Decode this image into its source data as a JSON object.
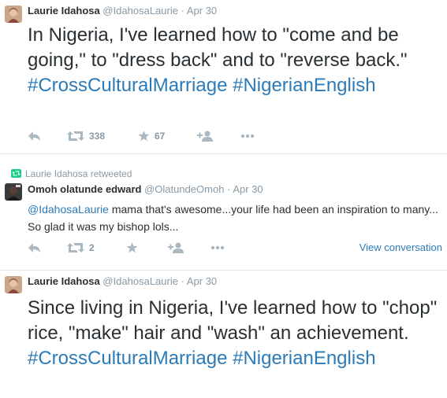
{
  "tweets": [
    {
      "name": "Laurie Idahosa",
      "handle": "@IdahosaLaurie",
      "dot": "·",
      "date": "Apr 30",
      "text_parts": [
        "In Nigeria, I've learned how to \"come and be going,\" to \"dress back\" and to \"reverse back.\" ",
        "#CrossCulturalMarriage",
        " ",
        "#NigerianEnglish"
      ],
      "actions": {
        "reply_icon": "reply-icon",
        "retweet_icon": "retweet-icon",
        "retweet_count": "338",
        "favorite_icon": "star-icon",
        "favorite_count": "67",
        "follow_icon": "follow-user-icon",
        "more_icon": "more-dots-icon"
      }
    },
    {
      "retweeted_by": "Laurie Idahosa retweeted",
      "name": "Omoh olatunde edward",
      "handle": "@OlatundeOmoh",
      "dot": "·",
      "date": "Apr 30",
      "mention": "@IdahosaLaurie",
      "text": " mama that's awesome...your life had been an inspiration to many... So glad it was my bishop lols...",
      "actions": {
        "reply_icon": "reply-icon",
        "retweet_icon": "retweet-icon",
        "retweet_count": "2",
        "favorite_icon": "star-icon",
        "follow_icon": "follow-user-icon",
        "more_icon": "more-dots-icon",
        "view_conversation": "View conversation"
      }
    },
    {
      "name": "Laurie Idahosa",
      "handle": "@IdahosaLaurie",
      "dot": "·",
      "date": "Apr 30",
      "text_parts": [
        "Since living in Nigeria, I've learned how to \"chop\" rice, \"make\" hair and \"wash\" an achievement. ",
        "#CrossCulturalMarriage",
        " ",
        "#NigerianEnglish"
      ]
    }
  ],
  "colors": {
    "link": "#2b7bb9",
    "muted": "#8899a6",
    "icon": "#aab8c2",
    "text": "#292f33",
    "retweet_green": "#19cf86"
  }
}
